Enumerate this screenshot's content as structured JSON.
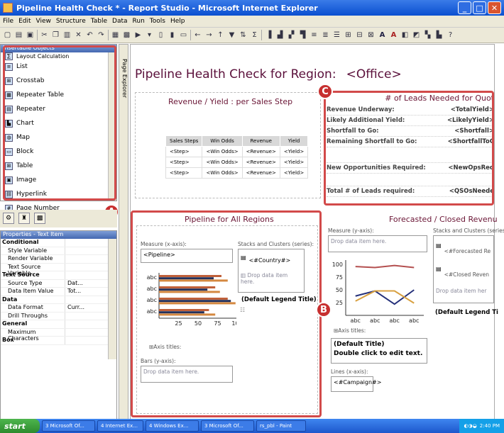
{
  "window": {
    "title": "Pipeline Health Check * - Report Studio - Microsoft Internet Explorer"
  },
  "menu": [
    "File",
    "Edit",
    "View",
    "Structure",
    "Table",
    "Data",
    "Run",
    "Tools",
    "Help"
  ],
  "insertable": {
    "title": "Insertable Objects",
    "items": [
      "Layout Calculation",
      "List",
      "Crosstab",
      "Repeater Table",
      "Repeater",
      "Chart",
      "Map",
      "Block",
      "Table",
      "Image",
      "Hyperlink",
      "Page Number"
    ]
  },
  "page_explorer": "Page Explorer",
  "properties": {
    "title": "Properties - Text Item",
    "rows": [
      {
        "k": "Conditional",
        "v": "",
        "hdr": true
      },
      {
        "k": "Style Variable",
        "v": ""
      },
      {
        "k": "Render Variable",
        "v": ""
      },
      {
        "k": "Text Source Variable",
        "v": ""
      },
      {
        "k": "Text Source",
        "v": "",
        "hdr": true
      },
      {
        "k": "Source Type",
        "v": "Dat..."
      },
      {
        "k": "Data Item Value",
        "v": "Tot..."
      },
      {
        "k": "Data",
        "v": "",
        "hdr": true
      },
      {
        "k": "Data Format",
        "v": "Curr..."
      },
      {
        "k": "Drill Throughs",
        "v": ""
      },
      {
        "k": "General",
        "v": "",
        "hdr": true
      },
      {
        "k": "Maximum Characters",
        "v": ""
      },
      {
        "k": "Box",
        "v": "",
        "hdr": true
      }
    ]
  },
  "report": {
    "title": "Pipeline Health Check for Region:",
    "title_ph": "<Office>",
    "revenue": {
      "title": "Revenue / Yield : per Sales Step",
      "headers": [
        "Sales Steps",
        "Win Odds",
        "Revenue",
        "Yield"
      ],
      "rows": [
        [
          "<Step>",
          "<Win Odds>",
          "<Revenue>",
          "<Yield>"
        ],
        [
          "<Step>",
          "<Win Odds>",
          "<Revenue>",
          "<Yield>"
        ],
        [
          "<Step>",
          "<Win Odds>",
          "<Revenue>",
          "<Yield>"
        ]
      ]
    },
    "leads": {
      "title": "# of Leads Needed for Quot",
      "rows": [
        [
          "Revenue Underway:",
          "<TotalYield>"
        ],
        [
          "Likely Additional Yield:",
          "<LikelyYield>"
        ],
        [
          "Shortfall to Go:",
          "<Shortfall>"
        ],
        [
          "Remaining Shortfall to Go:",
          "<ShortfallToC"
        ],
        [
          "",
          ""
        ],
        [
          "New Opportunities Required:",
          "<NewOpsReq"
        ],
        [
          "",
          ""
        ],
        [
          "Total # of Leads required:",
          "<QSOsNeede"
        ]
      ]
    },
    "pipeline": {
      "title": "Pipeline for All Regions",
      "measure_label": "Measure (x-axis):",
      "measure_value": "<Pipeline>",
      "stacks_label": "Stacks and Clusters (series):",
      "stacks_value": "<#Country#>",
      "drop": "Drop data item here.",
      "legend": "(Default Legend Title)",
      "axis_titles": "Axis titles:",
      "bars_label": "Bars (y-axis):",
      "ticks": [
        "25",
        "50",
        "75",
        "100"
      ],
      "cats": [
        "abc",
        "abc",
        "abc",
        "abc"
      ]
    },
    "forecast": {
      "title": "Forecasted / Closed Revenu",
      "measure_label": "Measure (y-axis):",
      "drop": "Drop data item here.",
      "stacks_label": "Stacks and Clusters (series",
      "s1": "<#Forecasted Re",
      "s2": "<#Closed Reven",
      "drop2": "Drop data item her",
      "legend": "(Default Legend Ti",
      "ticks": [
        "100",
        "75",
        "50",
        "25"
      ],
      "cats": [
        "abc",
        "abc",
        "abc",
        "abc"
      ],
      "axis_titles": "Axis titles:",
      "default_title": "(Default Title)",
      "dbl": "Double click to edit text.",
      "lines_label": "Lines (x-axis):",
      "lines_value": "<#Campaign#>"
    }
  },
  "badges": {
    "a": "A",
    "b": "B",
    "c": "C"
  },
  "taskbar": {
    "start": "start",
    "tasks": [
      "3 Microsoft Of...",
      "4 Internet Ex...",
      "4 Windows Ex...",
      "3 Microsoft Of...",
      "rs_pbl - Paint"
    ],
    "time": "2:40 PM"
  },
  "chart_data": [
    {
      "type": "bar",
      "categories": [
        "abc",
        "abc",
        "abc",
        "abc"
      ],
      "series": [
        {
          "values": [
            80,
            72,
            88,
            64
          ]
        },
        {
          "values": [
            70,
            62,
            92,
            58
          ]
        },
        {
          "values": [
            88,
            78,
            98,
            72
          ]
        }
      ],
      "xlim": [
        0,
        100
      ]
    },
    {
      "type": "line",
      "categories": [
        "abc",
        "abc",
        "abc",
        "abc"
      ],
      "series": [
        {
          "values": [
            96,
            94,
            98,
            94
          ]
        },
        {
          "values": [
            38,
            48,
            22,
            50
          ]
        },
        {
          "values": [
            28,
            48,
            48,
            24
          ]
        }
      ],
      "ylim": [
        0,
        100
      ]
    }
  ]
}
